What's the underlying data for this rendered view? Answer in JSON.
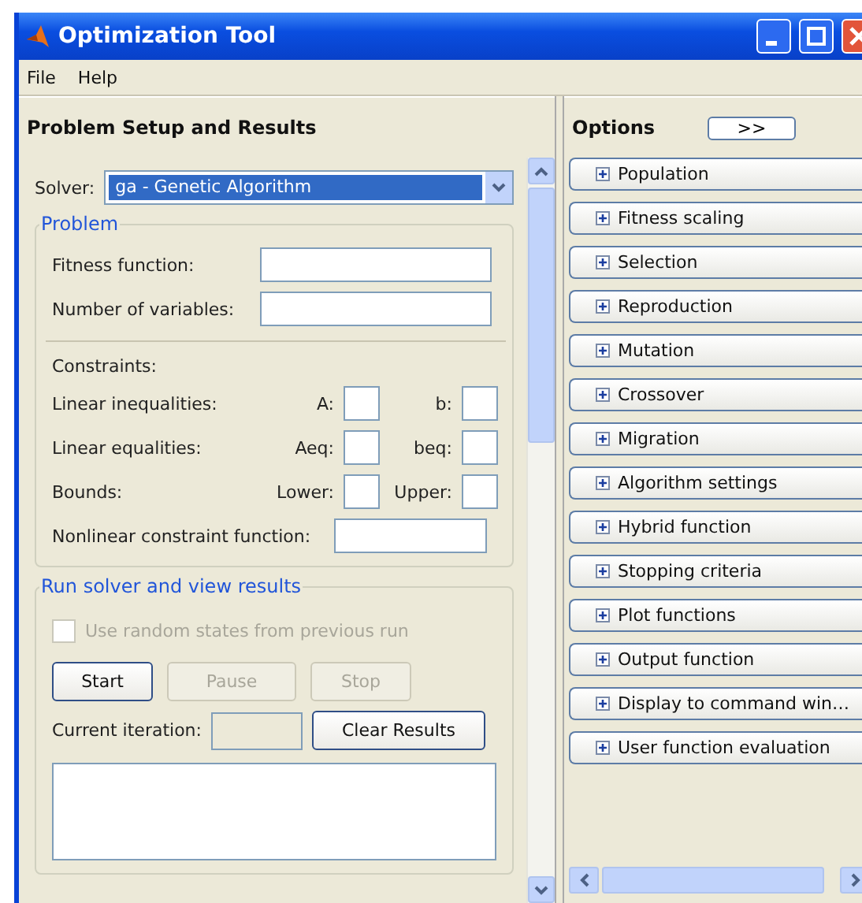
{
  "window": {
    "title": "Optimization Tool"
  },
  "menu": [
    "File",
    "Help"
  ],
  "left_panel": {
    "title": "Problem Setup and Results",
    "solver": {
      "label": "Solver:",
      "value": "ga - Genetic Algorithm"
    },
    "problem": {
      "title": "Problem",
      "fields": [
        {
          "label": "Fitness function:"
        },
        {
          "label": "Number of variables:"
        }
      ],
      "constraints_title": "Constraints:",
      "constraints": [
        {
          "label": "Linear inequalities:",
          "a_label": "A:",
          "b_label": "b:"
        },
        {
          "label": "Linear equalities:",
          "a_label": "Aeq:",
          "b_label": "beq:"
        },
        {
          "label": "Bounds:",
          "a_label": "Lower:",
          "b_label": "Upper:"
        }
      ],
      "nonlinear": {
        "label": "Nonlinear constraint function:"
      }
    },
    "run": {
      "title": "Run solver and view results",
      "checkbox": {
        "label": "Use random states from previous run",
        "checked": false,
        "disabled": true
      },
      "buttons": [
        {
          "label": "Start",
          "disabled": false
        },
        {
          "label": "Pause",
          "disabled": true
        },
        {
          "label": "Stop",
          "disabled": true
        }
      ],
      "iteration_label": "Current iteration:",
      "clear_button": "Clear Results"
    }
  },
  "options": {
    "title": "Options",
    "toggle_button": ">>",
    "items": [
      {
        "label": "Population",
        "expanded": false
      },
      {
        "label": "Fitness scaling",
        "expanded": false
      },
      {
        "label": "Selection",
        "expanded": false
      },
      {
        "label": "Reproduction",
        "expanded": false
      },
      {
        "label": "Mutation",
        "expanded": false
      },
      {
        "label": "Crossover",
        "expanded": false
      },
      {
        "label": "Migration",
        "expanded": false
      },
      {
        "label": "Algorithm settings",
        "expanded": false
      },
      {
        "label": "Hybrid function",
        "expanded": false
      },
      {
        "label": "Stopping criteria",
        "expanded": false
      },
      {
        "label": "Plot functions",
        "expanded": false
      },
      {
        "label": "Output function",
        "expanded": false
      },
      {
        "label": "Display to command win…",
        "expanded": false
      },
      {
        "label": "User function evaluation",
        "expanded": false
      }
    ]
  }
}
